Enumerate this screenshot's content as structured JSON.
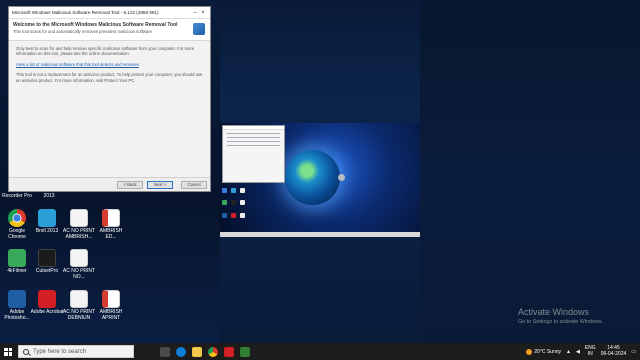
{
  "dialog": {
    "title": "Microsoft Windows Malicious Software Removal Tool - 5.122 (4858 991)",
    "heading": "Welcome to the Microsoft Windows Malicious Software Removal Tool",
    "subheading": "This tool scans for and automatically removes prevalent malicious software",
    "para1": "Only best to scan for and help remove specific malicious software from your computer. For more information on this tool, please see the online documentation.",
    "link1": "View a list of malicious software that this tool detects and removes",
    "para2": "This tool is not a replacement for an antivirus product. To help protect your computer, you should use an antivirus product. For more information, visit Protect Your PC.",
    "back_label": "< Back",
    "next_label": "Next >",
    "cancel_label": "Cancel"
  },
  "desktop_icons": [
    {
      "label": "Recorder Pro",
      "icon": "recorder-icon"
    },
    {
      "label": "2013",
      "icon": "folder-icon"
    },
    {
      "label": "Google Chrome",
      "icon": "chrome-icon"
    },
    {
      "label": "Brstl 2013",
      "icon": "brstl-icon"
    },
    {
      "label": "AC NO PRINT AMBRISH...",
      "icon": "document-icon"
    },
    {
      "label": "AMBRISH ED...",
      "icon": "pdf-icon"
    },
    {
      "label": "4kFilmer",
      "icon": "video-icon"
    },
    {
      "label": "CutsetPro",
      "icon": "cut-icon"
    },
    {
      "label": "AC NO PRINT NO...",
      "icon": "document-icon"
    },
    {
      "label": "Adobe Photosho...",
      "icon": "photoshop-icon"
    },
    {
      "label": "Adobe Acrobat",
      "icon": "acrobat-icon"
    },
    {
      "label": "AC NO PRINT DEBNIUN",
      "icon": "document-icon"
    },
    {
      "label": "AMBRISH APRINT",
      "icon": "pdf-icon"
    }
  ],
  "watermark": {
    "title": "Activate Windows",
    "subtitle": "Go to Settings to activate Windows."
  },
  "taskbar": {
    "search_placeholder": "Type here to search",
    "weather": "20°C Sunny",
    "lang_top": "ENG",
    "lang_bottom": "IN",
    "time": "14:45",
    "date": "06-04-2024"
  }
}
